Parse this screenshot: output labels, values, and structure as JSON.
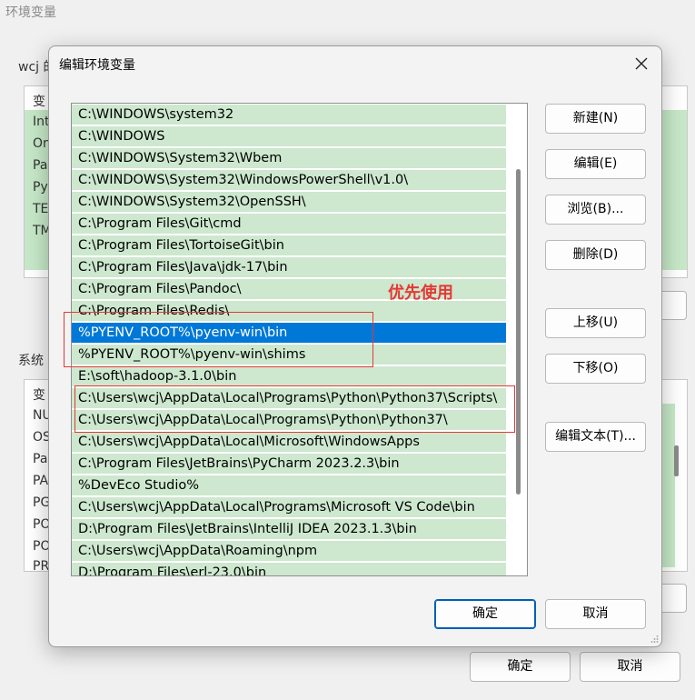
{
  "parent": {
    "title": "环境变量",
    "user_group_label": "wcj 的",
    "user_vars_header": "变",
    "user_vars": [
      "Int",
      "On",
      "Pa",
      "Py",
      "TE",
      "TM"
    ],
    "system_group_label": "系统",
    "system_vars_header": "变",
    "system_vars": [
      "NU",
      "OS",
      "Pa",
      "PA",
      "PG",
      "PO",
      "PO",
      "PR"
    ],
    "ok_label": "确定",
    "cancel_label": "取消"
  },
  "dialog": {
    "title": "编辑环境变量",
    "paths": [
      "C:\\WINDOWS\\system32",
      "C:\\WINDOWS",
      "C:\\WINDOWS\\System32\\Wbem",
      "C:\\WINDOWS\\System32\\WindowsPowerShell\\v1.0\\",
      "C:\\WINDOWS\\System32\\OpenSSH\\",
      "C:\\Program Files\\Git\\cmd",
      "C:\\Program Files\\TortoiseGit\\bin",
      "C:\\Program Files\\Java\\jdk-17\\bin",
      "C:\\Program Files\\Pandoc\\",
      "C:\\Program Files\\Redis\\",
      "%PYENV_ROOT%\\pyenv-win\\bin",
      "%PYENV_ROOT%\\pyenv-win\\shims",
      "E:\\soft\\hadoop-3.1.0\\bin",
      "C:\\Users\\wcj\\AppData\\Local\\Programs\\Python\\Python37\\Scripts\\",
      "C:\\Users\\wcj\\AppData\\Local\\Programs\\Python\\Python37\\",
      "C:\\Users\\wcj\\AppData\\Local\\Microsoft\\WindowsApps",
      "C:\\Program Files\\JetBrains\\PyCharm 2023.2.3\\bin",
      "%DevEco Studio%",
      "C:\\Users\\wcj\\AppData\\Local\\Programs\\Microsoft VS Code\\bin",
      "D:\\Program Files\\JetBrains\\IntelliJ IDEA 2023.1.3\\bin",
      "C:\\Users\\wcj\\AppData\\Roaming\\npm",
      "D:\\Program Files\\erl-23.0\\bin"
    ],
    "selected_index": 10,
    "buttons": {
      "new": "新建(N)",
      "edit": "编辑(E)",
      "browse": "浏览(B)...",
      "delete": "删除(D)",
      "move_up": "上移(U)",
      "move_down": "下移(O)",
      "edit_text": "编辑文本(T)..."
    },
    "ok_label": "确定",
    "cancel_label": "取消"
  },
  "annotation": {
    "text": "优先使用",
    "color": "#e53935"
  },
  "colors": {
    "selected_row": "#0078d7",
    "row_highlight": "#cde8cf",
    "ok_border": "#005fb8"
  }
}
